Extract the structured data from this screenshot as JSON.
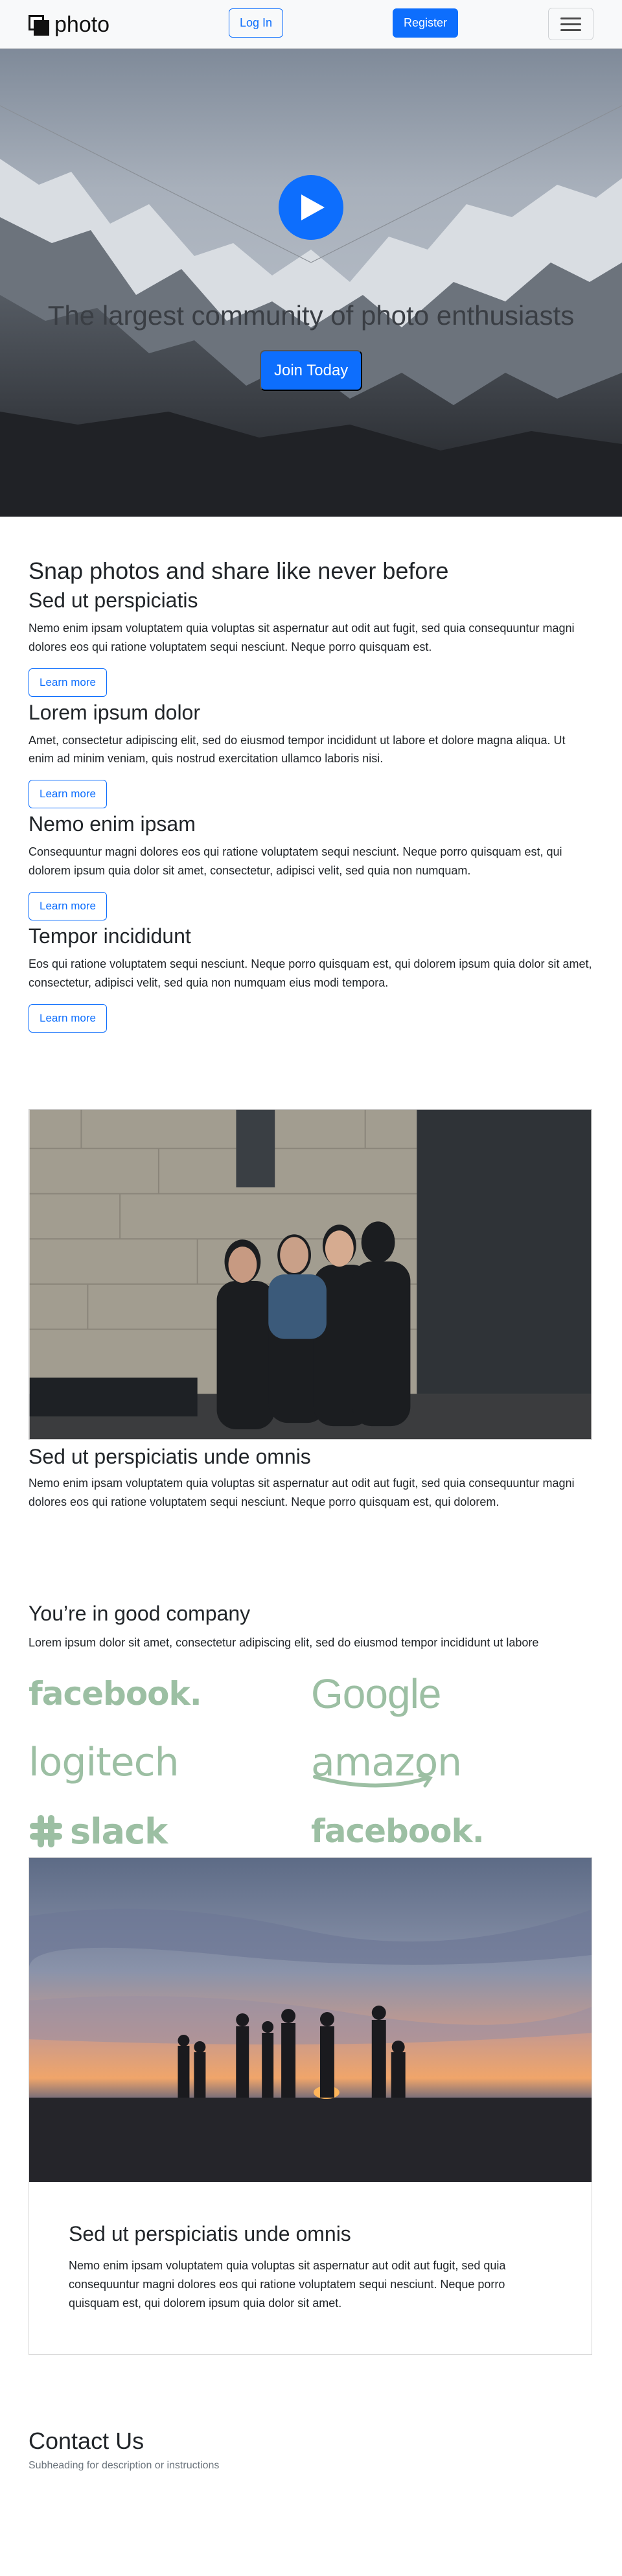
{
  "nav": {
    "brand": "photo",
    "login": "Log In",
    "register": "Register"
  },
  "hero": {
    "title": "The largest community of photo enthusiasts",
    "cta": "Join Today"
  },
  "features": {
    "heading": "Snap photos and share like never before",
    "items": [
      {
        "title": "Sed ut perspiciatis",
        "text": "Nemo enim ipsam voluptatem quia voluptas sit aspernatur aut odit aut fugit, sed quia consequuntur magni dolores eos qui ratione voluptatem sequi nesciunt. Neque porro quisquam est.",
        "button": "Learn more"
      },
      {
        "title": "Lorem ipsum dolor",
        "text": "Amet, consectetur adipiscing elit, sed do eiusmod tempor incididunt ut labore et dolore magna aliqua. Ut enim ad minim veniam, quis nostrud exercitation ullamco laboris nisi.",
        "button": "Learn more"
      },
      {
        "title": "Nemo enim ipsam",
        "text": "Consequuntur magni dolores eos qui ratione voluptatem sequi nesciunt. Neque porro quisquam est, qui dolorem ipsum quia dolor sit amet, consectetur, adipisci velit, sed quia non numquam.",
        "button": "Learn more"
      },
      {
        "title": "Tempor incididunt",
        "text": "Eos qui ratione voluptatem sequi nesciunt. Neque porro quisquam est, qui dolorem ipsum quia dolor sit amet, consectetur, adipisci velit, sed quia non numquam eius modi tempora.",
        "button": "Learn more"
      }
    ]
  },
  "photo_section": {
    "title": "Sed ut perspiciatis unde omnis",
    "text": "Nemo enim ipsam voluptatem quia voluptas sit aspernatur aut odit aut fugit, sed quia consequuntur magni dolores eos qui ratione voluptatem sequi nesciunt. Neque porro quisquam est, qui dolorem."
  },
  "company": {
    "heading": "You’re in good company",
    "text": "Lorem ipsum dolor sit amet, consectetur adipiscing elit, sed do eiusmod tempor incididunt ut labore",
    "logos": [
      "facebook.",
      "Google",
      "logitech",
      "amazon",
      "slack",
      "facebook."
    ]
  },
  "card": {
    "title": "Sed ut perspiciatis unde omnis",
    "text": "Nemo enim ipsam voluptatem quia voluptas sit aspernatur aut odit aut fugit, sed quia consequuntur magni dolores eos qui ratione voluptatem sequi nesciunt. Neque porro quisquam est, qui dolorem ipsum quia dolor sit amet."
  },
  "contact": {
    "heading": "Contact Us",
    "subheading": "Subheading for description or instructions"
  },
  "colors": {
    "primary": "#0d6efd",
    "logo": "#9cbfa3"
  }
}
